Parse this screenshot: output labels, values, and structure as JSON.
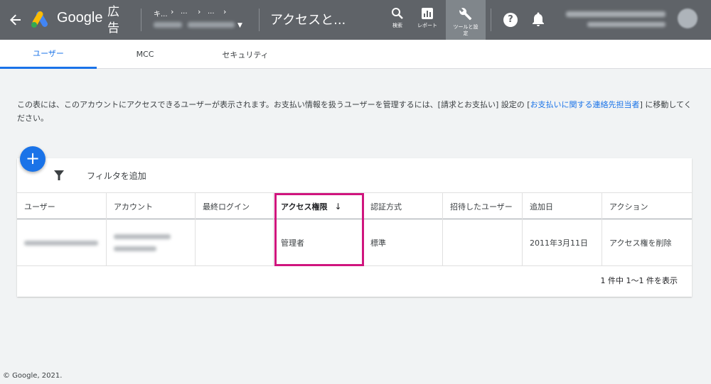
{
  "colors": {
    "header_bg": "#5f6368",
    "accent": "#1a73e8",
    "highlight": "#d0157e"
  },
  "header": {
    "product_word": "Google",
    "product_suffix": "広告",
    "breadcrumb": [
      "キ...",
      "...",
      "..."
    ],
    "page_title": "アクセスと...",
    "tools": [
      {
        "icon": "search-icon",
        "label": "検索"
      },
      {
        "icon": "report-icon",
        "label": "レポート"
      },
      {
        "icon": "wrench-icon",
        "label": "ツールと設定",
        "active": true
      }
    ],
    "help_glyph": "?"
  },
  "tabs": [
    {
      "label": "ユーザー",
      "active": true
    },
    {
      "label": "MCC",
      "active": false
    },
    {
      "label": "セキュリティ",
      "active": false
    }
  ],
  "info": {
    "text_before": "この表には、このアカウントにアクセスできるユーザーが表示されます。お支払い情報を扱うユーザーを管理するには、[請求とお支払い] 設定の [",
    "link": "お支払いに関する連絡先担当者",
    "text_after": "] に移動してください。"
  },
  "toolbar": {
    "add_glyph": "+",
    "filter_label": "フィルタを追加"
  },
  "table": {
    "columns": [
      "ユーザー",
      "アカウント",
      "最終ログイン",
      "アクセス権限",
      "認証方式",
      "招待したユーザー",
      "追加日",
      "アクション"
    ],
    "sorted_column": "アクセス権限",
    "sort_arrow": "↓",
    "rows": [
      {
        "user": "",
        "account": "",
        "last_login": "",
        "access": "管理者",
        "auth": "標準",
        "invited_by": "",
        "added": "2011年3月11日",
        "action": "アクセス権を削除"
      }
    ],
    "pagination": "1 件中 1〜1 件を表示"
  },
  "footer": "© Google, 2021."
}
